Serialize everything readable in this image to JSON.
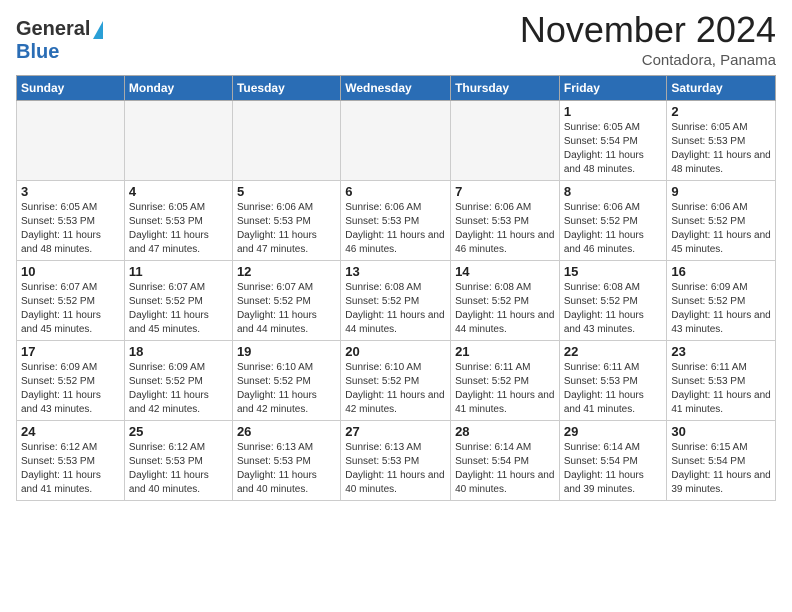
{
  "header": {
    "logo_general": "General",
    "logo_blue": "Blue",
    "month_title": "November 2024",
    "subtitle": "Contadora, Panama"
  },
  "calendar": {
    "weekdays": [
      "Sunday",
      "Monday",
      "Tuesday",
      "Wednesday",
      "Thursday",
      "Friday",
      "Saturday"
    ],
    "weeks": [
      [
        {
          "day": "",
          "empty": true
        },
        {
          "day": "",
          "empty": true
        },
        {
          "day": "",
          "empty": true
        },
        {
          "day": "",
          "empty": true
        },
        {
          "day": "",
          "empty": true
        },
        {
          "day": "1",
          "sunrise": "Sunrise: 6:05 AM",
          "sunset": "Sunset: 5:54 PM",
          "daylight": "Daylight: 11 hours and 48 minutes."
        },
        {
          "day": "2",
          "sunrise": "Sunrise: 6:05 AM",
          "sunset": "Sunset: 5:53 PM",
          "daylight": "Daylight: 11 hours and 48 minutes."
        }
      ],
      [
        {
          "day": "3",
          "sunrise": "Sunrise: 6:05 AM",
          "sunset": "Sunset: 5:53 PM",
          "daylight": "Daylight: 11 hours and 48 minutes."
        },
        {
          "day": "4",
          "sunrise": "Sunrise: 6:05 AM",
          "sunset": "Sunset: 5:53 PM",
          "daylight": "Daylight: 11 hours and 47 minutes."
        },
        {
          "day": "5",
          "sunrise": "Sunrise: 6:06 AM",
          "sunset": "Sunset: 5:53 PM",
          "daylight": "Daylight: 11 hours and 47 minutes."
        },
        {
          "day": "6",
          "sunrise": "Sunrise: 6:06 AM",
          "sunset": "Sunset: 5:53 PM",
          "daylight": "Daylight: 11 hours and 46 minutes."
        },
        {
          "day": "7",
          "sunrise": "Sunrise: 6:06 AM",
          "sunset": "Sunset: 5:53 PM",
          "daylight": "Daylight: 11 hours and 46 minutes."
        },
        {
          "day": "8",
          "sunrise": "Sunrise: 6:06 AM",
          "sunset": "Sunset: 5:52 PM",
          "daylight": "Daylight: 11 hours and 46 minutes."
        },
        {
          "day": "9",
          "sunrise": "Sunrise: 6:06 AM",
          "sunset": "Sunset: 5:52 PM",
          "daylight": "Daylight: 11 hours and 45 minutes."
        }
      ],
      [
        {
          "day": "10",
          "sunrise": "Sunrise: 6:07 AM",
          "sunset": "Sunset: 5:52 PM",
          "daylight": "Daylight: 11 hours and 45 minutes."
        },
        {
          "day": "11",
          "sunrise": "Sunrise: 6:07 AM",
          "sunset": "Sunset: 5:52 PM",
          "daylight": "Daylight: 11 hours and 45 minutes."
        },
        {
          "day": "12",
          "sunrise": "Sunrise: 6:07 AM",
          "sunset": "Sunset: 5:52 PM",
          "daylight": "Daylight: 11 hours and 44 minutes."
        },
        {
          "day": "13",
          "sunrise": "Sunrise: 6:08 AM",
          "sunset": "Sunset: 5:52 PM",
          "daylight": "Daylight: 11 hours and 44 minutes."
        },
        {
          "day": "14",
          "sunrise": "Sunrise: 6:08 AM",
          "sunset": "Sunset: 5:52 PM",
          "daylight": "Daylight: 11 hours and 44 minutes."
        },
        {
          "day": "15",
          "sunrise": "Sunrise: 6:08 AM",
          "sunset": "Sunset: 5:52 PM",
          "daylight": "Daylight: 11 hours and 43 minutes."
        },
        {
          "day": "16",
          "sunrise": "Sunrise: 6:09 AM",
          "sunset": "Sunset: 5:52 PM",
          "daylight": "Daylight: 11 hours and 43 minutes."
        }
      ],
      [
        {
          "day": "17",
          "sunrise": "Sunrise: 6:09 AM",
          "sunset": "Sunset: 5:52 PM",
          "daylight": "Daylight: 11 hours and 43 minutes."
        },
        {
          "day": "18",
          "sunrise": "Sunrise: 6:09 AM",
          "sunset": "Sunset: 5:52 PM",
          "daylight": "Daylight: 11 hours and 42 minutes."
        },
        {
          "day": "19",
          "sunrise": "Sunrise: 6:10 AM",
          "sunset": "Sunset: 5:52 PM",
          "daylight": "Daylight: 11 hours and 42 minutes."
        },
        {
          "day": "20",
          "sunrise": "Sunrise: 6:10 AM",
          "sunset": "Sunset: 5:52 PM",
          "daylight": "Daylight: 11 hours and 42 minutes."
        },
        {
          "day": "21",
          "sunrise": "Sunrise: 6:11 AM",
          "sunset": "Sunset: 5:52 PM",
          "daylight": "Daylight: 11 hours and 41 minutes."
        },
        {
          "day": "22",
          "sunrise": "Sunrise: 6:11 AM",
          "sunset": "Sunset: 5:53 PM",
          "daylight": "Daylight: 11 hours and 41 minutes."
        },
        {
          "day": "23",
          "sunrise": "Sunrise: 6:11 AM",
          "sunset": "Sunset: 5:53 PM",
          "daylight": "Daylight: 11 hours and 41 minutes."
        }
      ],
      [
        {
          "day": "24",
          "sunrise": "Sunrise: 6:12 AM",
          "sunset": "Sunset: 5:53 PM",
          "daylight": "Daylight: 11 hours and 41 minutes."
        },
        {
          "day": "25",
          "sunrise": "Sunrise: 6:12 AM",
          "sunset": "Sunset: 5:53 PM",
          "daylight": "Daylight: 11 hours and 40 minutes."
        },
        {
          "day": "26",
          "sunrise": "Sunrise: 6:13 AM",
          "sunset": "Sunset: 5:53 PM",
          "daylight": "Daylight: 11 hours and 40 minutes."
        },
        {
          "day": "27",
          "sunrise": "Sunrise: 6:13 AM",
          "sunset": "Sunset: 5:53 PM",
          "daylight": "Daylight: 11 hours and 40 minutes."
        },
        {
          "day": "28",
          "sunrise": "Sunrise: 6:14 AM",
          "sunset": "Sunset: 5:54 PM",
          "daylight": "Daylight: 11 hours and 40 minutes."
        },
        {
          "day": "29",
          "sunrise": "Sunrise: 6:14 AM",
          "sunset": "Sunset: 5:54 PM",
          "daylight": "Daylight: 11 hours and 39 minutes."
        },
        {
          "day": "30",
          "sunrise": "Sunrise: 6:15 AM",
          "sunset": "Sunset: 5:54 PM",
          "daylight": "Daylight: 11 hours and 39 minutes."
        }
      ]
    ]
  }
}
